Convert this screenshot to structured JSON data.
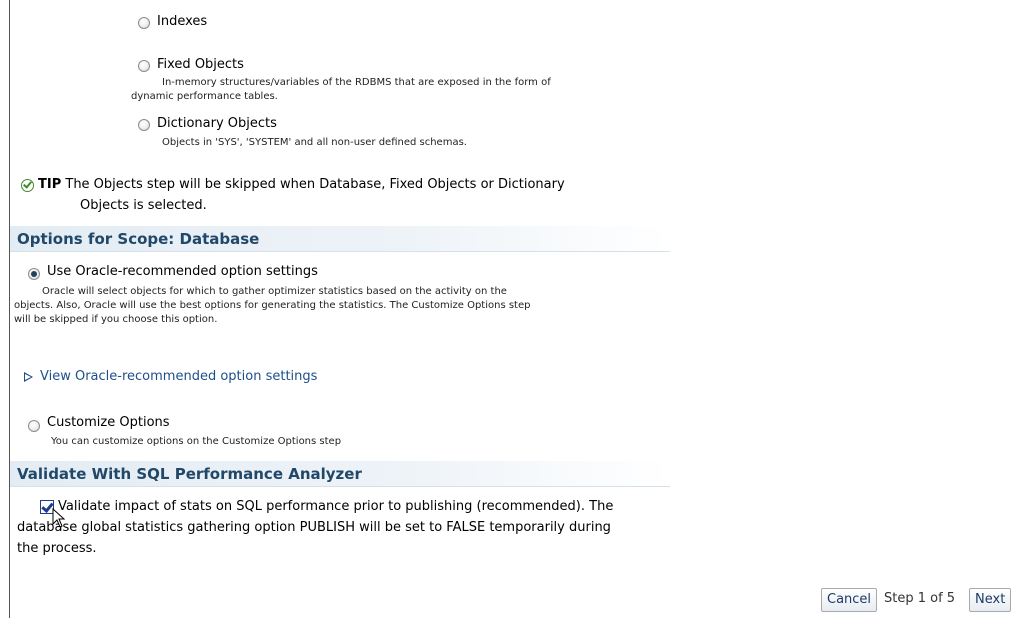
{
  "scope_options": [
    {
      "label": "Indexes",
      "description": ""
    },
    {
      "label": "Fixed Objects",
      "description_line1": "In-memory structures/variables of the RDBMS that are exposed in the form of",
      "description_line2": "dynamic performance tables."
    },
    {
      "label": "Dictionary Objects",
      "description": "Objects in 'SYS', 'SYSTEM' and all non-user defined schemas."
    }
  ],
  "tip": {
    "prefix": "TIP",
    "line1": "The Objects step will be skipped when Database, Fixed Objects or Dictionary",
    "line2": "Objects is selected."
  },
  "options_section": {
    "title": "Options for Scope: Database",
    "recommended_label": "Use Oracle-recommended option settings",
    "recommended_desc1": "Oracle will select objects for which to gather optimizer statistics based on the activity on the",
    "recommended_desc2": "objects. Also, Oracle will use the best options for generating the statistics. The Customize Options step",
    "recommended_desc3": "will be skipped if you choose this option.",
    "view_link": "View Oracle-recommended option settings",
    "customize_label": "Customize Options",
    "customize_desc": "You can customize options on the Customize Options step"
  },
  "validate_section": {
    "title": "Validate With SQL Performance Analyzer",
    "checkbox_line1": "Validate impact of stats on SQL performance prior to publishing (recommended). The",
    "checkbox_line2": "database global statistics gathering option PUBLISH will be set to FALSE temporarily during",
    "checkbox_line3": "the process.",
    "checked": true
  },
  "footer": {
    "cancel": "Cancel",
    "step": "Step 1 of 5",
    "next": "Next"
  },
  "colors": {
    "header_text": "#214868",
    "link": "#1f4f8a",
    "tip_icon": "#3f8a2c"
  }
}
